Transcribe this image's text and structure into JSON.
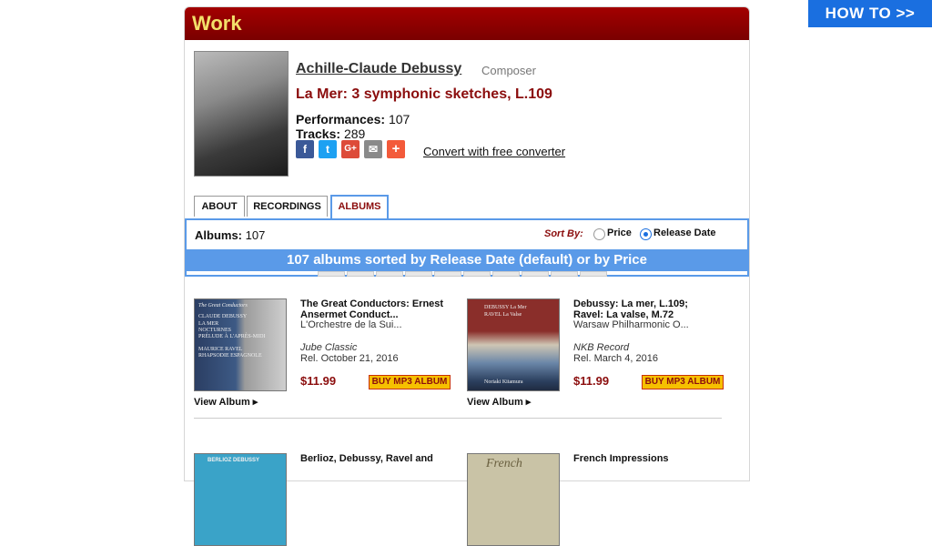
{
  "howto": "HOW TO >>",
  "panel": {
    "title": "Work"
  },
  "work": {
    "composer": "Achille-Claude Debussy",
    "role": "Composer",
    "title": "La Mer: 3 symphonic sketches, L.109",
    "performances_label": "Performances:",
    "performances": "107",
    "tracks_label": "Tracks:",
    "tracks": "289",
    "convert": "Convert with free converter"
  },
  "share_icons": [
    "facebook-icon",
    "twitter-icon",
    "google-plus-icon",
    "email-icon",
    "add-icon"
  ],
  "tabs": [
    {
      "label": "ABOUT",
      "active": false
    },
    {
      "label": "RECORDINGS",
      "active": false
    },
    {
      "label": "ALBUMS",
      "active": true
    }
  ],
  "albums_header": {
    "label": "Albums:",
    "count": "107",
    "sort_by": "Sort By:",
    "sort_options": [
      {
        "label": "Price",
        "selected": false
      },
      {
        "label": "Release Date",
        "selected": true
      }
    ],
    "banner": "107 albums sorted by Release Date (default) or by Price"
  },
  "albums": [
    {
      "title_line1": "The Great Conductors: Ernest",
      "title_line2": "Ansermet Conduct...",
      "performer": "L'Orchestre de la Sui...",
      "label": "Jube Classic",
      "release": "Rel. October 21, 2016",
      "price": "$11.99",
      "buy": "BUY MP3 ALBUM",
      "view": "View Album ▸"
    },
    {
      "title_line1": "Debussy: La mer, L.109;",
      "title_line2": "Ravel: La valse, M.72",
      "performer": "Warsaw Philharmonic O...",
      "label": "NKB Record",
      "release": "Rel. March 4, 2016",
      "price": "$11.99",
      "buy": "BUY MP3 ALBUM",
      "view": "View Album ▸"
    },
    {
      "title_line1": "Berlioz, Debussy, Ravel and"
    },
    {
      "title_line1": "French Impressions"
    }
  ],
  "cover1_text": [
    "The Great Conductors",
    "CLAUDE DEBUSSY",
    "LA MER",
    "NOCTURNES",
    "PRÉLUDE À L'APRÈS-MIDI",
    "MAURICE RAVEL",
    "RHAPSODIE ESPAGNOLE"
  ],
  "cover2_text": [
    "DEBUSSY  La Mer",
    "RAVEL  La Valse",
    "Noriaki Kitamura"
  ],
  "cover3_text": "BERLIOZ DEBUSSY",
  "cover4_text": "French",
  "colors": {
    "header": "#8b0000",
    "accent": "#5a9ae8",
    "title_red": "#8b0d0d",
    "buy_bg": "#f6c000"
  }
}
